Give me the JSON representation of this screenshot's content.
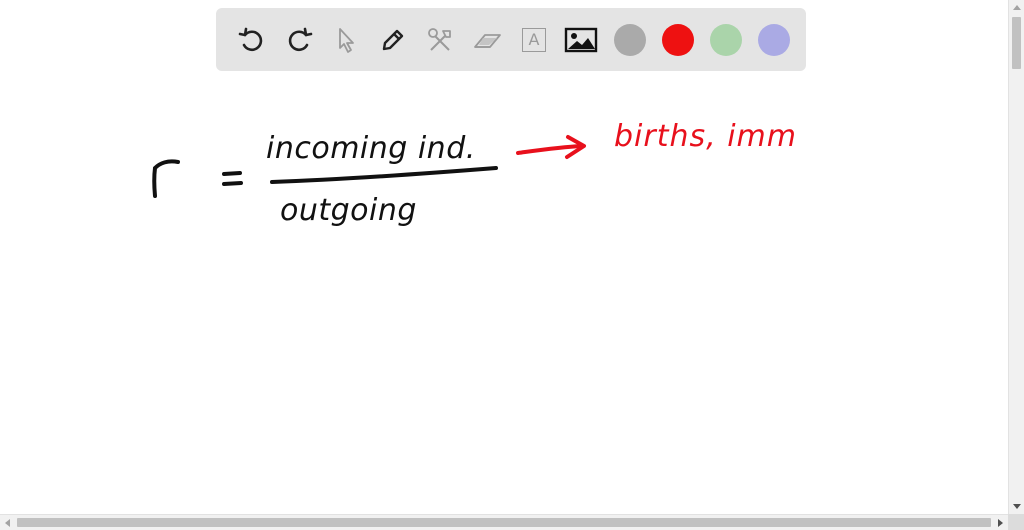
{
  "toolbar": {
    "tools": [
      {
        "name": "undo-icon"
      },
      {
        "name": "redo-icon"
      },
      {
        "name": "select-pointer-icon"
      },
      {
        "name": "pen-icon"
      },
      {
        "name": "tools-icon"
      },
      {
        "name": "eraser-icon"
      },
      {
        "name": "text-box-icon",
        "glyph": "A"
      },
      {
        "name": "image-icon"
      }
    ],
    "colors": [
      {
        "name": "gray",
        "hex": "#aaaaaa"
      },
      {
        "name": "red",
        "hex": "#ee1111"
      },
      {
        "name": "green",
        "hex": "#aad4aa"
      },
      {
        "name": "blue",
        "hex": "#aaaae4"
      }
    ]
  },
  "handwriting": {
    "variable": "r",
    "equals": "=",
    "numerator": "incoming ind.",
    "denominator": "outgoing",
    "arrow_target": "births, imm"
  },
  "colors": {
    "ink_black": "#111111",
    "ink_red": "#e8101c",
    "toolbar_bg": "#e4e4e4"
  }
}
